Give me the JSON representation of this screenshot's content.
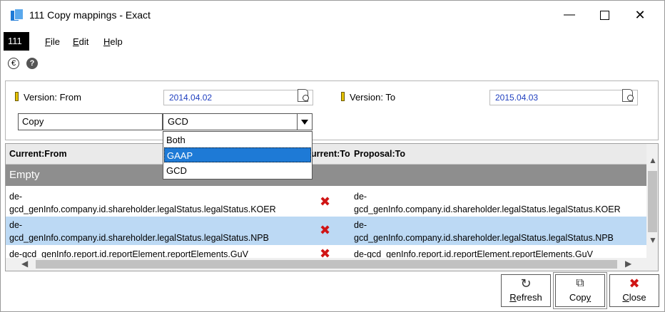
{
  "window": {
    "title": "111 Copy mappings - Exact",
    "minimize_glyph": "—",
    "close_glyph": "✕"
  },
  "menubar": {
    "badge": "111",
    "items": [
      {
        "label": "File",
        "accel": "F",
        "rest": "ile"
      },
      {
        "label": "Edit",
        "accel": "E",
        "rest": "dit"
      },
      {
        "label": "Help",
        "accel": "H",
        "rest": "elp"
      }
    ]
  },
  "toolbar_icons": {
    "euro": "€",
    "help": "?"
  },
  "criteria": {
    "version_from_label": "Version: From",
    "version_from_value": "2014.04.02",
    "version_to_label": "Version: To",
    "version_to_value": "2015.04.03",
    "copy_label": "Copy",
    "copy_selected": "GCD"
  },
  "dropdown": {
    "options": [
      "Both",
      "GAAP",
      "GCD"
    ],
    "highlighted": "GAAP"
  },
  "grid": {
    "columns": [
      "Current:From",
      "urrent:To",
      "Proposal:To"
    ],
    "group_label": "Empty",
    "rows": [
      {
        "from_line1": "de-",
        "from_line2": "gcd_genInfo.company.id.shareholder.legalStatus.legalStatus.KOER",
        "to_line1": "de-",
        "to_line2": "gcd_genInfo.company.id.shareholder.legalStatus.legalStatus.KOER",
        "selected": false
      },
      {
        "from_line1": "de-",
        "from_line2": "gcd_genInfo.company.id.shareholder.legalStatus.legalStatus.NPB",
        "to_line1": "de-",
        "to_line2": "gcd_genInfo.company.id.shareholder.legalStatus.legalStatus.NPB",
        "selected": true
      },
      {
        "from_line1": "de-gcd_genInfo.report.id.reportElement.reportElements.GuV",
        "from_line2": "",
        "to_line1": "de-gcd_genInfo.report.id.reportElement.reportElements.GuV",
        "to_line2": "",
        "selected": false
      }
    ],
    "mark_glyph": "✖"
  },
  "buttons": {
    "refresh": {
      "label": "Refresh",
      "accel": "R",
      "rest": "efresh",
      "glyph": "↻"
    },
    "copy": {
      "label": "Copy",
      "pre": "Cop",
      "accel": "y",
      "glyph": "⧉"
    },
    "close": {
      "label": "Close",
      "accel": "C",
      "rest": "lose",
      "glyph": "✖"
    }
  },
  "colors": {
    "selected_row": "#bcd9f4",
    "group_header": "#8e8e8e",
    "highlight": "#1e7ad6",
    "date_text": "#1f3fbf",
    "delete_mark": "#d01515"
  }
}
